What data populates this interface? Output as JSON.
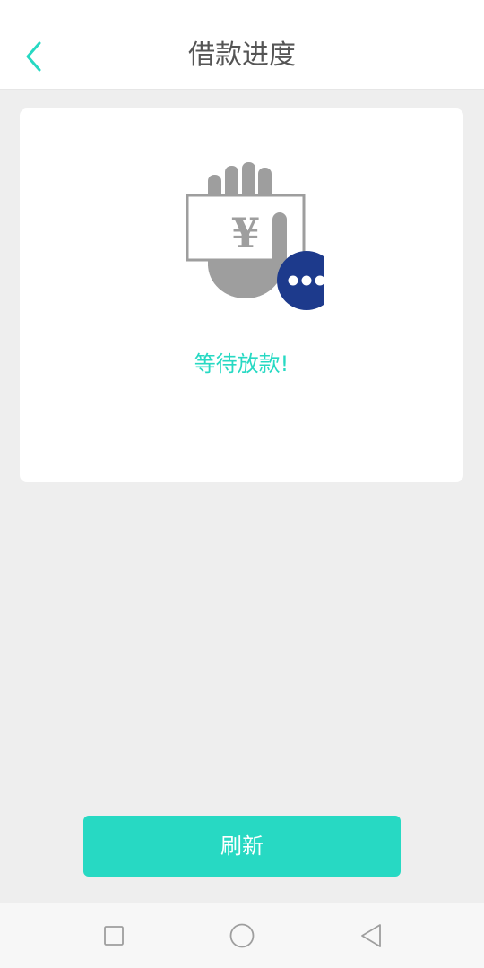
{
  "header": {
    "title": "借款进度",
    "back_icon": "chevron-left-icon"
  },
  "status": {
    "icon": "hand-money-waiting-icon",
    "message": "等待放款!"
  },
  "actions": {
    "refresh_label": "刷新"
  },
  "system_nav": {
    "items": [
      "recent-apps-icon",
      "home-icon",
      "back-icon"
    ]
  },
  "colors": {
    "accent": "#27d9c3",
    "badge": "#1d3a8c",
    "illustration_gray": "#9e9e9e",
    "background": "#eeeeee"
  }
}
